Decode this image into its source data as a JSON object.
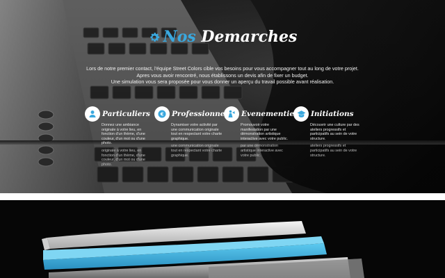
{
  "header": {
    "title_accent": "Nos",
    "title_main": "Demarches",
    "icon": "gear-icon",
    "accent_color": "#3aa8de"
  },
  "intro": {
    "line1": "Lors de notre premier contact, l'équipe Street Colors cible vos besoins pour vous accompagner tout au long de votre projet.",
    "line2": "Apres vous avoir rencontré, nous établissons un devis afin de fixer un budget.",
    "line3": "Une simulation vous sera proposée pour vous donner un aperçu du travail possible avant réalisation."
  },
  "features": [
    {
      "icon": "user-icon",
      "title": "Particuliers",
      "text": "Donnez une ambiance originale à votre lieu, en fonction d'un thème, d'une couleur, d'un mot ou d'une photo.",
      "ghost": "originale à votre lieu, en fonction d'un thème, d'une couleur, d'un mot ou d'une photo."
    },
    {
      "icon": "euro-icon",
      "title": "Professionnels",
      "text": "Dynamiser votre activité par une communication originale tout en respectant votre charte graphique.",
      "ghost": "une communication originale tout en respectant votre charte graphique."
    },
    {
      "icon": "person-arrow-icon",
      "title": "Evenementiel",
      "text": "Promouvoir votre manifestation par une démonstration artistique interactive avec votre public.",
      "ghost": "par une démonstration artistique interactive avec votre public."
    },
    {
      "icon": "graduation-cap-icon",
      "title": "Initiations",
      "text": "Découvrir une culture par des ateliers progressifs et participatifs au sein de votre structure.",
      "ghost": "ateliers progressifs et participatifs au sein de votre structure."
    }
  ]
}
